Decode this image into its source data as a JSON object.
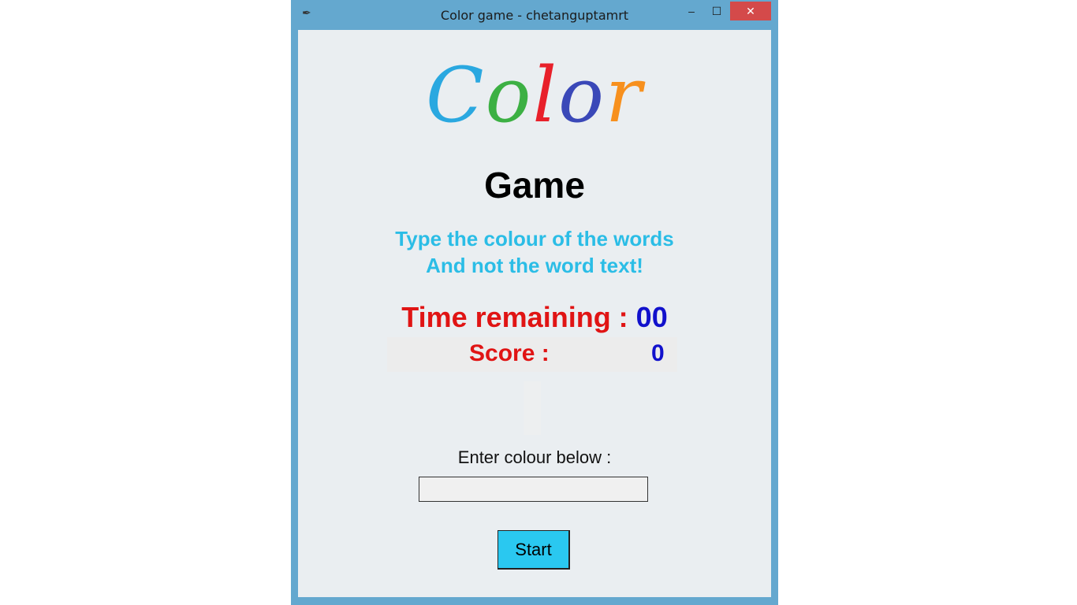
{
  "window": {
    "title": "Color game - chetanguptamrt",
    "app_icon": "feather-icon",
    "minimize_glyph": "–",
    "maximize_glyph": "☐",
    "close_glyph": "✕"
  },
  "logo": {
    "letters": [
      {
        "char": "C",
        "color": "#2aa8e0"
      },
      {
        "char": "o",
        "color": "#3cb043"
      },
      {
        "char": "l",
        "color": "#e8202a"
      },
      {
        "char": "o",
        "color": "#3a48b8"
      },
      {
        "char": "r",
        "color": "#f7901e"
      }
    ]
  },
  "subtitle": "Game",
  "instructions": {
    "line1": "Type the colour of the words",
    "line2": "And not the word text!"
  },
  "timer": {
    "label": "Time remaining : ",
    "value": "00"
  },
  "score": {
    "label": "Score :",
    "value": "0"
  },
  "input": {
    "label": "Enter colour below :",
    "value": "",
    "placeholder": ""
  },
  "start_button": {
    "label": "Start"
  },
  "colors": {
    "accent_cyan": "#2bbde6",
    "label_red": "#e01414",
    "value_blue": "#1111cc",
    "button_bg": "#2ac8f0",
    "window_frame": "#64a8cf",
    "close_red": "#d44a4a"
  }
}
